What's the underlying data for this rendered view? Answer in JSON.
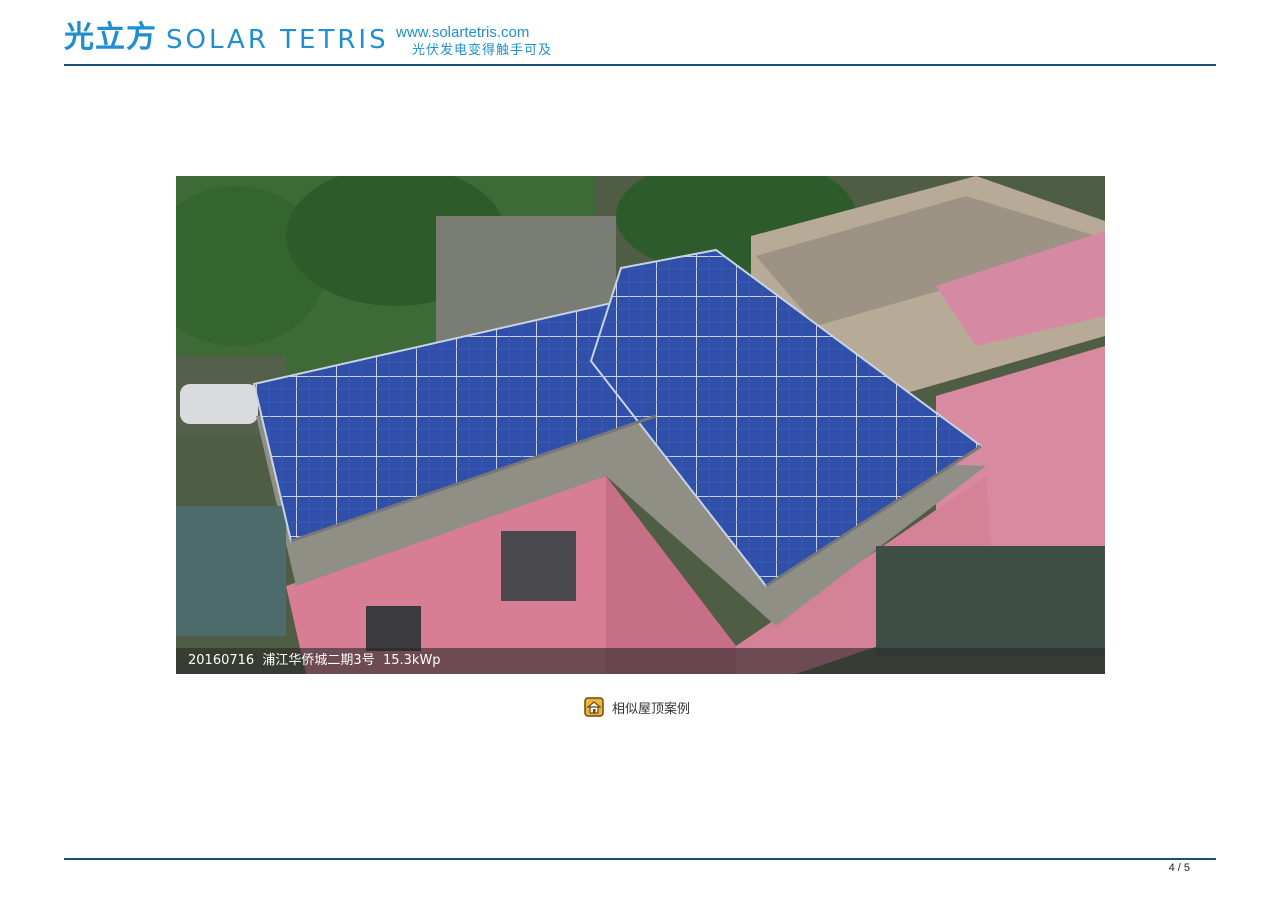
{
  "header": {
    "logo_cn": "光立方",
    "logo_en": "SOLAR TETRIS",
    "website": "www.solartetris.com",
    "slogan": "光伏发电变得触手可及"
  },
  "photo": {
    "caption": "20160716  浦江华侨城二期3号  15.3kWp"
  },
  "case_link": {
    "label": "相似屋顶案例",
    "icon": "house-icon"
  },
  "footer": {
    "page_number": "4 / 5"
  },
  "colors": {
    "brand_blue": "#1f8fd0",
    "rule_navy": "#1b4f7a",
    "panel_blue": "#2f4fa8",
    "wall_pink": "#d77e95"
  }
}
